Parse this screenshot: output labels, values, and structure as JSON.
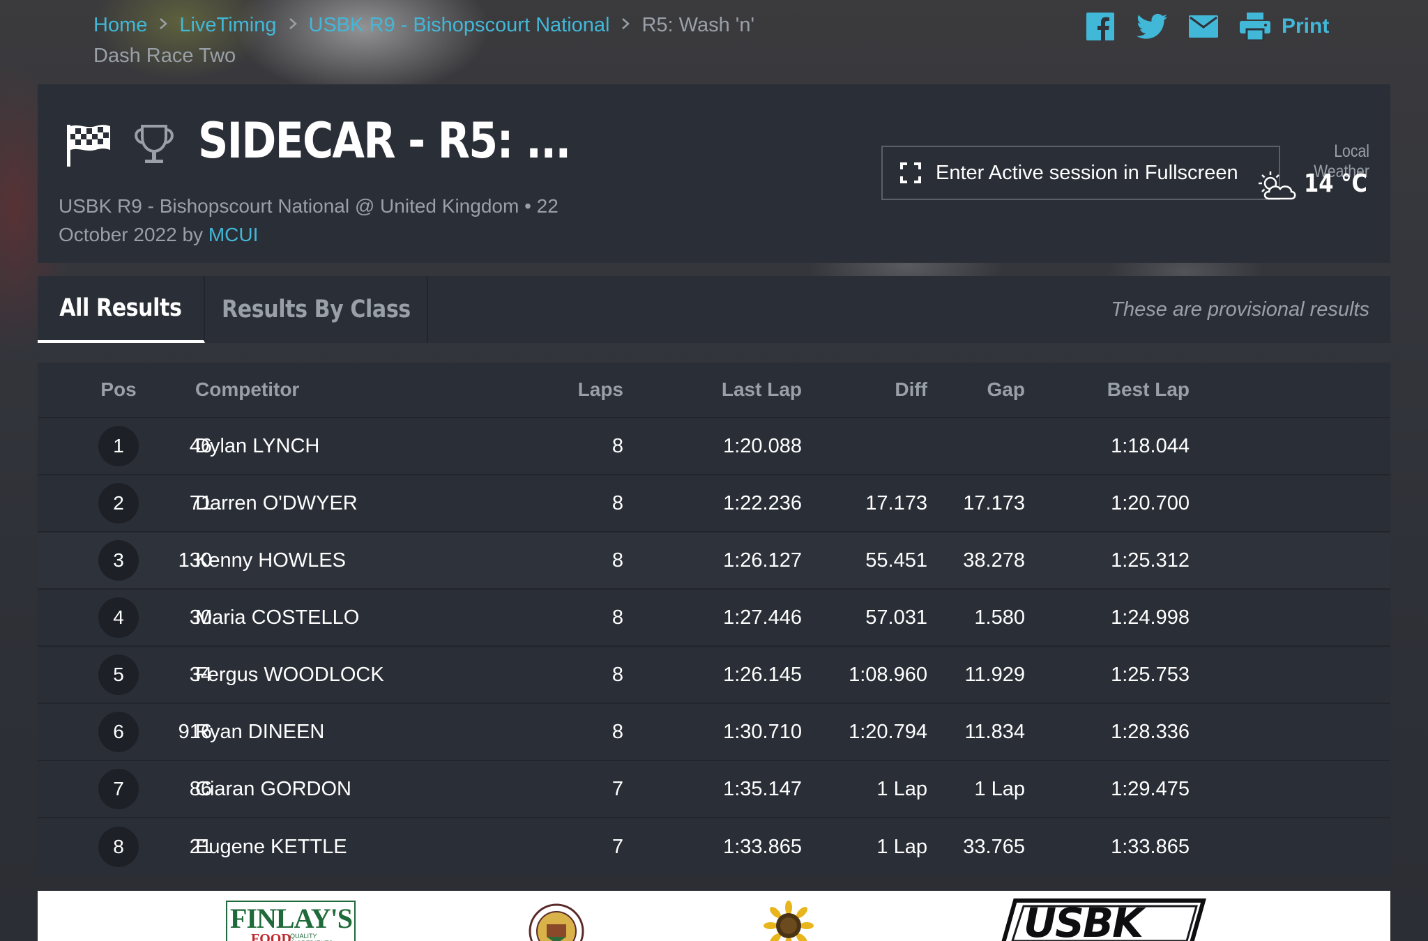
{
  "breadcrumb": {
    "items": [
      "Home",
      "LiveTiming",
      "USBK R9 - Bishopscourt National"
    ],
    "current": "R5: Wash 'n' Dash Race Two"
  },
  "share": {
    "icons": [
      "facebook-icon",
      "twitter-icon",
      "email-icon",
      "print-icon"
    ],
    "print_label": "Print"
  },
  "session": {
    "title": "SIDECAR - R5: ...",
    "event": "USBK R9 - Bishopscourt National",
    "location": "United Kingdom",
    "date": "22 October 2022",
    "meta_text": "USBK R9 - Bishopscourt National @ United Kingdom • 22 October 2022 by ",
    "author": "MCUI",
    "fullscreen_label": "Enter Active session in Fullscreen",
    "weather_label": "Local Weather",
    "temperature": "14 °C"
  },
  "tabs": {
    "items": [
      {
        "label": "All Results",
        "active": true
      },
      {
        "label": "Results By Class",
        "active": false
      }
    ],
    "notice": "These are provisional results"
  },
  "table": {
    "headers": {
      "pos": "Pos",
      "competitor": "Competitor",
      "laps": "Laps",
      "last_lap": "Last Lap",
      "diff": "Diff",
      "gap": "Gap",
      "best_lap": "Best Lap"
    },
    "rows": [
      {
        "pos": "1",
        "num": "46",
        "name": "Dylan LYNCH",
        "laps": "8",
        "last": "1:20.088",
        "diff": "",
        "gap": "",
        "best": "1:18.044"
      },
      {
        "pos": "2",
        "num": "71",
        "name": "Darren O'DWYER",
        "laps": "8",
        "last": "1:22.236",
        "diff": "17.173",
        "gap": "17.173",
        "best": "1:20.700"
      },
      {
        "pos": "3",
        "num": "130",
        "name": "Kenny HOWLES",
        "laps": "8",
        "last": "1:26.127",
        "diff": "55.451",
        "gap": "38.278",
        "best": "1:25.312"
      },
      {
        "pos": "4",
        "num": "30",
        "name": "Maria COSTELLO",
        "laps": "8",
        "last": "1:27.446",
        "diff": "57.031",
        "gap": "1.580",
        "best": "1:24.998"
      },
      {
        "pos": "5",
        "num": "34",
        "name": "Fergus WOODLOCK",
        "laps": "8",
        "last": "1:26.145",
        "diff": "1:08.960",
        "gap": "11.929",
        "best": "1:25.753"
      },
      {
        "pos": "6",
        "num": "916",
        "name": "Ryan DINEEN",
        "laps": "8",
        "last": "1:30.710",
        "diff": "1:20.794",
        "gap": "11.834",
        "best": "1:28.336"
      },
      {
        "pos": "7",
        "num": "86",
        "name": "Ciaran GORDON",
        "laps": "7",
        "last": "1:35.147",
        "diff": "1 Lap",
        "gap": "1 Lap",
        "best": "1:29.475"
      },
      {
        "pos": "8",
        "num": "21",
        "name": "Eugene KETTLE",
        "laps": "7",
        "last": "1:33.865",
        "diff": "1 Lap",
        "gap": "33.765",
        "best": "1:33.865"
      }
    ]
  },
  "sponsors": {
    "finlays": "FINLAY'S",
    "finlays_sub": "FOOD",
    "finlays_tag": "QUALITY INGREDIENTS",
    "usbk": "USBK"
  },
  "colors": {
    "accent": "#42b8d8",
    "panel": "#2a2e36",
    "muted": "#9aa0a8"
  }
}
